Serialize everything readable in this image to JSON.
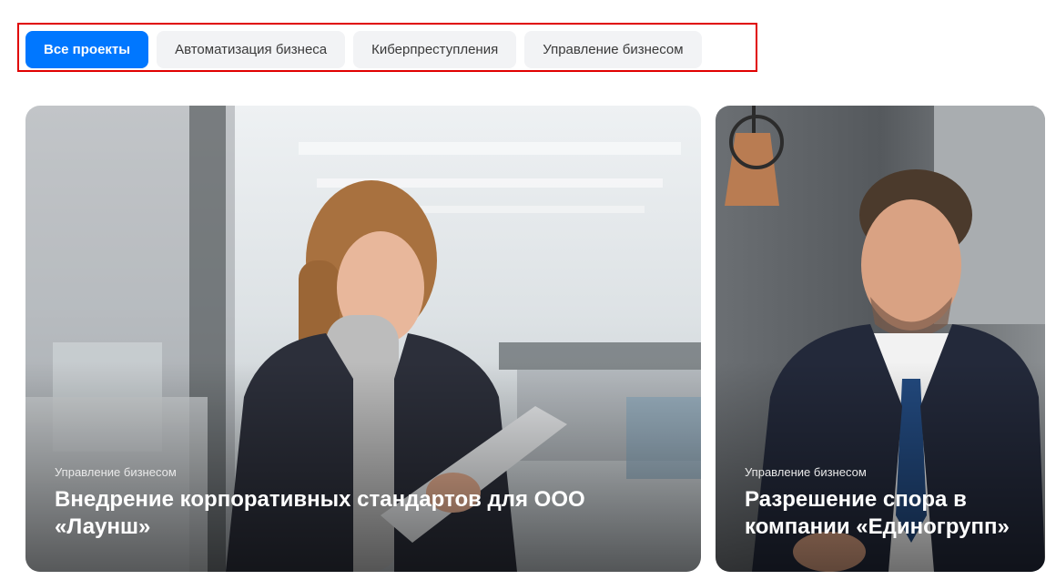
{
  "filters": {
    "items": [
      {
        "label": "Все проекты",
        "active": true
      },
      {
        "label": "Автоматизация бизнеса",
        "active": false
      },
      {
        "label": "Киберпреступления",
        "active": false
      },
      {
        "label": "Управление бизнесом",
        "active": false
      }
    ],
    "active_color": "#0077ff",
    "inactive_color": "#f2f3f5",
    "highlight_border_color": "#e00000"
  },
  "cards": [
    {
      "tag": "Управление бизнесом",
      "title": "Внедрение корпоративных стандартов для ООО «Лаунш»",
      "image": "woman-in-office-photo"
    },
    {
      "tag": "Управление бизнесом",
      "title": "Разрешение спора в компании «Единогрупп»",
      "image": "smiling-man-handshake-photo"
    }
  ]
}
